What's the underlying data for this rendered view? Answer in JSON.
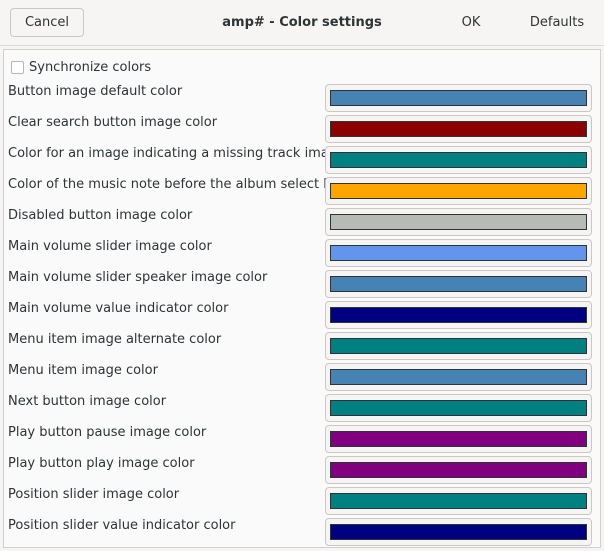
{
  "header": {
    "title": "amp# - Color settings",
    "cancel_label": "Cancel",
    "ok_label": "OK",
    "defaults_label": "Defaults"
  },
  "synchronize": {
    "label": "Synchronize colors",
    "checked": false
  },
  "rows": [
    {
      "label": "Button image default color",
      "color": "#4682b4"
    },
    {
      "label": "Clear search button image color",
      "color": "#8b0000"
    },
    {
      "label": "Color for an image indicating a missing track image",
      "color": "#008080"
    },
    {
      "label": "Color of the music note before the album select box",
      "color": "#ffa500"
    },
    {
      "label": "Disabled button image color",
      "color": "#b6bbb5"
    },
    {
      "label": "Main volume slider image color",
      "color": "#6495ed"
    },
    {
      "label": "Main volume slider speaker image color",
      "color": "#4682b4"
    },
    {
      "label": "Main volume value indicator color",
      "color": "#000080"
    },
    {
      "label": "Menu item image alternate color",
      "color": "#008080"
    },
    {
      "label": "Menu item image color",
      "color": "#4682b4"
    },
    {
      "label": "Next button image color",
      "color": "#008080"
    },
    {
      "label": "Play button pause image color",
      "color": "#800080"
    },
    {
      "label": "Play button play image color",
      "color": "#800080"
    },
    {
      "label": "Position slider image color",
      "color": "#008080"
    },
    {
      "label": "Position slider value indicator color",
      "color": "#000080"
    }
  ]
}
